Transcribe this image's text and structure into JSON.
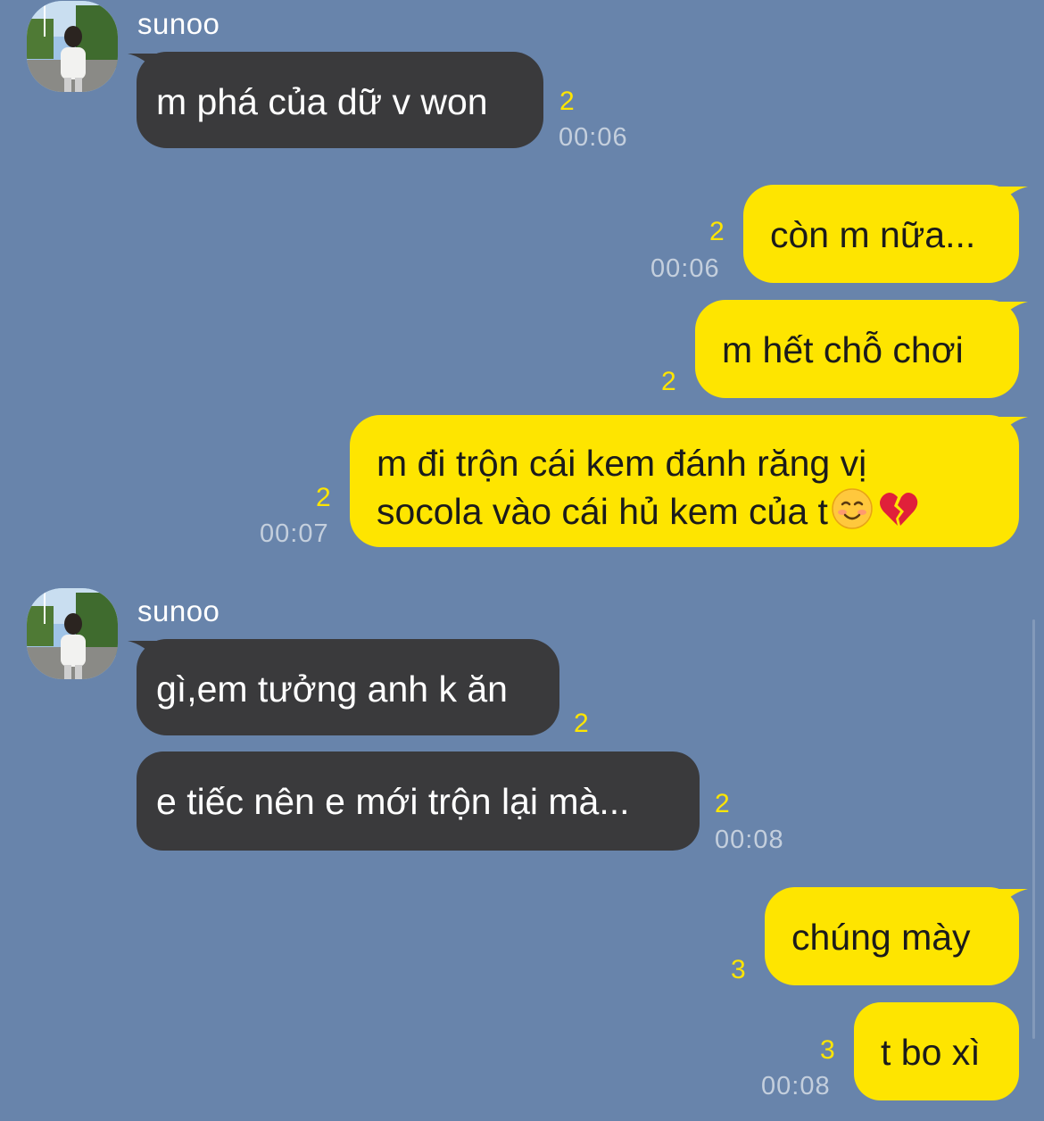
{
  "chat": {
    "colors": {
      "background": "#6884ab",
      "incoming_bubble": "#3a3a3c",
      "outgoing_bubble": "#fee500",
      "unread_count": "#fee500",
      "timestamp": "#c4cfdd"
    },
    "group1": {
      "sender": "sunoo",
      "messages": [
        {
          "text": "m phá của dữ v won",
          "unread": "2",
          "time": "00:06"
        }
      ]
    },
    "outgoing1": [
      {
        "text": "còn m nữa...",
        "unread": "2",
        "time": "00:06"
      },
      {
        "text": "m hết chỗ chơi",
        "unread": "2"
      },
      {
        "line1": "m đi trộn cái kem đánh răng vị",
        "line2": "socola vào cái hủ kem của t",
        "emojis": [
          "smiling-face-icon",
          "broken-heart-icon"
        ],
        "unread": "2",
        "time": "00:07"
      }
    ],
    "group2": {
      "sender": "sunoo",
      "messages": [
        {
          "text": "gì,em tưởng anh k ăn",
          "unread": "2"
        },
        {
          "text": "e tiếc nên e mới trộn lại mà...",
          "unread": "2",
          "time": "00:08"
        }
      ]
    },
    "outgoing2": [
      {
        "text": "chúng mày",
        "unread": "3"
      },
      {
        "text": "t bo xì",
        "unread": "3",
        "time": "00:08"
      }
    ]
  }
}
